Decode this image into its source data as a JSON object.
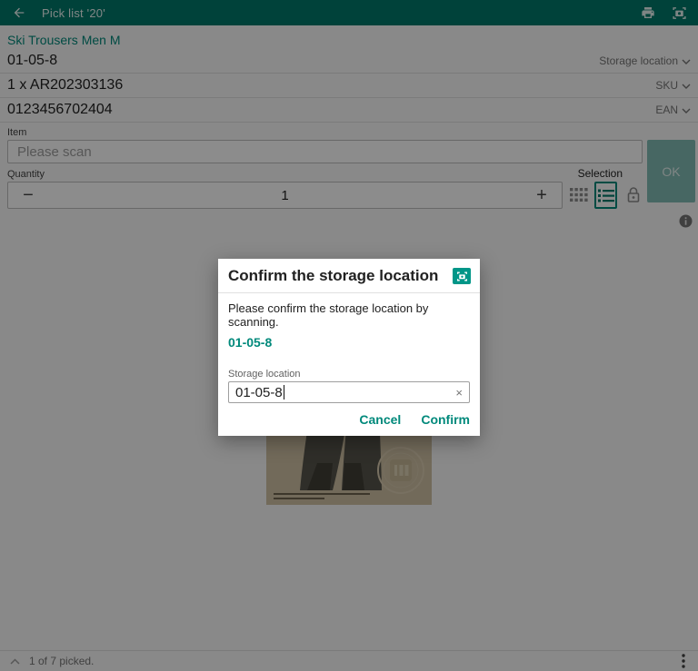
{
  "colors": {
    "accent": "#00897b",
    "header": "#00796b",
    "dialog_icon": "#009688"
  },
  "header": {
    "title": "Pick list '20'"
  },
  "product": {
    "name": "Ski Trousers Men M"
  },
  "fields": [
    {
      "value": "01-05-8",
      "label": "Storage location"
    },
    {
      "value": "1 x AR202303136",
      "label": "SKU"
    },
    {
      "value": "0123456702404",
      "label": "EAN"
    }
  ],
  "item": {
    "label": "Item",
    "placeholder": "Please scan"
  },
  "quantity": {
    "label": "Quantity",
    "value": "1",
    "minus_icon": "−",
    "plus_icon": "+"
  },
  "selection": {
    "label": "Selection"
  },
  "ok": {
    "label": "OK"
  },
  "dialog": {
    "title": "Confirm the storage location",
    "message": "Please confirm the storage location by scanning.",
    "location": "01-05-8",
    "input_label": "Storage location",
    "input_value": "01-05-8",
    "clear_icon": "×",
    "cancel": "Cancel",
    "confirm": "Confirm"
  },
  "footer": {
    "status": "1 of 7 picked."
  }
}
